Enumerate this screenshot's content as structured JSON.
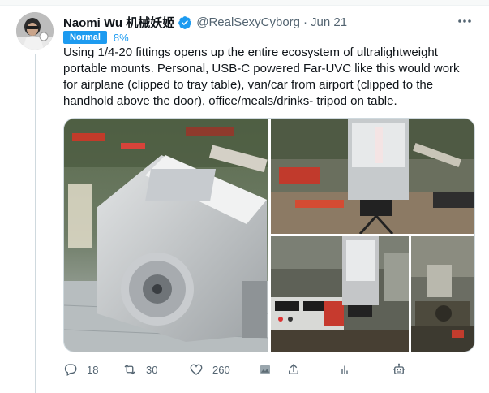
{
  "author": {
    "name": "Naomi Wu 机械妖姬",
    "handle": "@RealSexyCyborg",
    "separator": "·",
    "date": "Jun 21"
  },
  "score": {
    "badge": "Normal",
    "percent": "8%"
  },
  "tweet": {
    "text": "Using 1/4-20 fittings opens up the entire ecosystem of ultralightweight portable mounts. Personal, USB-C powered Far-UVC like this would work for airplane (clipped to tray table), van/car from airport (clipped to the handhold above the door), office/meals/drinks- tripod on table."
  },
  "actions": {
    "reply_count": "18",
    "retweet_count": "30",
    "like_count": "260"
  },
  "icons": {
    "verified": "verified-badge-icon",
    "more": "more-icon",
    "reply": "reply-icon",
    "retweet": "retweet-icon",
    "like": "heart-icon",
    "media_tag": "image-tag-icon",
    "share": "share-icon",
    "analytics": "analytics-icon",
    "bot": "robot-icon"
  },
  "colors": {
    "accent": "#1d9bf0",
    "muted": "#536471",
    "text": "#0f1419"
  }
}
